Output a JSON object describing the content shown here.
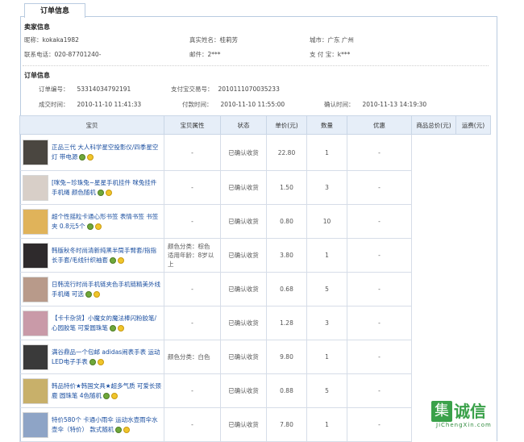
{
  "tab_label": "订单信息",
  "seller": {
    "title": "卖家信息",
    "nickname_label": "昵称：",
    "nickname": "kokaka1982",
    "realname_label": "真实姓名：",
    "realname": "桂莉芳",
    "city_label": "城市：",
    "city": "广东 广州",
    "phone_label": "联系电话：",
    "phone": "020-87701240-",
    "email_label": "邮件：",
    "email": "2***",
    "alipay_label": "支 付 宝：",
    "alipay": "k***"
  },
  "order": {
    "title": "订单信息",
    "order_no_label": "订单编号：",
    "order_no": "53314034792191",
    "trade_no_label": "支付宝交易号：",
    "trade_no": "2010111070035233",
    "created_label": "成交时间：",
    "created": "2010-11-10 11:41:33",
    "paid_label": "付款时间：",
    "paid": "2010-11-10 11:55:00",
    "confirmed_label": "确认时间：",
    "confirmed": "2010-11-13 14:19:30"
  },
  "table": {
    "headers": [
      "宝贝",
      "宝贝属性",
      "状态",
      "单价(元)",
      "数量",
      "优惠",
      "商品总价(元)",
      "运费(元)"
    ],
    "rows": [
      {
        "name": "正品三代 大人科学星空投影仪/四季星空灯 带电源",
        "attr": "-",
        "status": "已确认收货",
        "price": "22.80",
        "qty": "1",
        "discount": "-",
        "thumb": "#4a4640"
      },
      {
        "name": "[咪兔~珍珠兔~星星手机挂件 咪兔挂件手机绳 颜色随机",
        "attr": "-",
        "status": "已确认收货",
        "price": "1.50",
        "qty": "3",
        "discount": "-",
        "thumb": "#d8cfc8"
      },
      {
        "name": "超个性摇粒卡通心形书签 表情书签 书签夹 0.8元5个",
        "attr": "-",
        "status": "已确认收货",
        "price": "0.80",
        "qty": "10",
        "discount": "-",
        "thumb": "#e0b35a"
      },
      {
        "name": "韩版秋冬时尚清新纯黑半筒手臂套/指指长手套/毛线针织袖套",
        "attr": "颜色分类：棕色\n适用年龄：8岁以上",
        "status": "已确认收货",
        "price": "3.80",
        "qty": "1",
        "discount": "-",
        "thumb": "#2e2a2c"
      },
      {
        "name": "日韩流行时尚手机链夹色手机链精美外线手机绳 可选",
        "attr": "-",
        "status": "已确认收货",
        "price": "0.68",
        "qty": "5",
        "discount": "-",
        "thumb": "#b89a8a"
      },
      {
        "name": "【卡卡杂货】小魔女的魔法棒闪粉胶笔/心园胶笔 可爱圆珠笔",
        "attr": "-",
        "status": "已确认收货",
        "price": "1.28",
        "qty": "3",
        "discount": "-",
        "thumb": "#c99aa8"
      },
      {
        "name": "满谷鼎品一个包邮 adidas闹表手表 运动LED电子手表",
        "attr": "颜色分类：白色",
        "status": "已确认收货",
        "price": "9.80",
        "qty": "1",
        "discount": "-",
        "thumb": "#3a3a3a"
      },
      {
        "name": "韩品特价★韩国文具★超多气质 可爱长颈鹿 圆珠笔 4色随机",
        "attr": "-",
        "status": "已确认收货",
        "price": "0.88",
        "qty": "5",
        "discount": "-",
        "thumb": "#c8b06a"
      },
      {
        "name": "特价580个 卡通小雨伞 运动水壶雨伞水壶伞（特价） 款式随机",
        "attr": "-",
        "status": "已确认收货",
        "price": "7.80",
        "qty": "1",
        "discount": "-",
        "thumb": "#8ea4c6"
      }
    ]
  },
  "watermark": {
    "char": "集",
    "text": "诚信",
    "url": "JiChengXin.com"
  }
}
